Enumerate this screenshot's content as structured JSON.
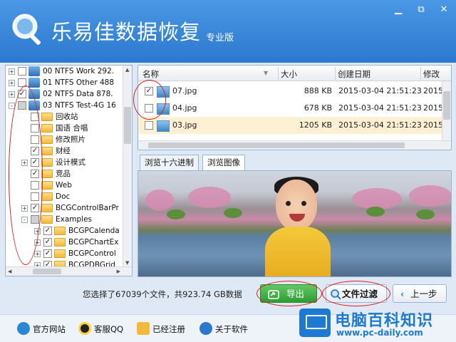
{
  "header": {
    "title": "乐易佳数据恢复",
    "edition": "专业版",
    "window_buttons": [
      "▁",
      "⧉",
      "✕"
    ]
  },
  "tree": {
    "rows": [
      {
        "indent": 0,
        "expander": "+",
        "checkbox": "unchecked",
        "icon": "drive",
        "label": "00  NTFS  Work  292."
      },
      {
        "indent": 0,
        "expander": "+",
        "checkbox": "unchecked",
        "icon": "drive",
        "label": "01  NTFS  Other  488"
      },
      {
        "indent": 0,
        "expander": "+",
        "checkbox": "checked",
        "icon": "drive",
        "label": "02  NTFS  Data  878."
      },
      {
        "indent": 0,
        "expander": "-",
        "checkbox": "partial",
        "icon": "drive",
        "label": "03  NTFS  Test-4G  16"
      },
      {
        "indent": 1,
        "expander": "",
        "checkbox": "unchecked",
        "icon": "folder",
        "label": "回收站"
      },
      {
        "indent": 1,
        "expander": "",
        "checkbox": "unchecked",
        "icon": "folder",
        "label": "国语 合唱"
      },
      {
        "indent": 1,
        "expander": "",
        "checkbox": "unchecked",
        "icon": "folder",
        "label": "修改照片"
      },
      {
        "indent": 1,
        "expander": "",
        "checkbox": "checked",
        "icon": "folder",
        "label": "财经"
      },
      {
        "indent": 1,
        "expander": "+",
        "checkbox": "checked",
        "icon": "folder",
        "label": "设计模式"
      },
      {
        "indent": 1,
        "expander": "",
        "checkbox": "checked",
        "icon": "folder",
        "label": "竞品"
      },
      {
        "indent": 1,
        "expander": "",
        "checkbox": "unchecked",
        "icon": "folder",
        "label": "Web"
      },
      {
        "indent": 1,
        "expander": "",
        "checkbox": "unchecked",
        "icon": "folder",
        "label": "Doc"
      },
      {
        "indent": 1,
        "expander": "+",
        "checkbox": "checked",
        "icon": "folder",
        "label": "BCGControlBarPr"
      },
      {
        "indent": 1,
        "expander": "-",
        "checkbox": "partial",
        "icon": "folder",
        "label": "Examples"
      },
      {
        "indent": 2,
        "expander": "+",
        "checkbox": "checked",
        "icon": "folder",
        "label": "BCGPCalenda"
      },
      {
        "indent": 2,
        "expander": "+",
        "checkbox": "checked",
        "icon": "folder",
        "label": "BCGPChartEx"
      },
      {
        "indent": 2,
        "expander": "+",
        "checkbox": "checked",
        "icon": "folder",
        "label": "BCGPControl"
      },
      {
        "indent": 2,
        "expander": "+",
        "checkbox": "checked",
        "icon": "folder",
        "label": "BCGPDBGrid"
      }
    ]
  },
  "filelist": {
    "columns": [
      "名称",
      "大小",
      "创建日期",
      "修改"
    ],
    "rows": [
      {
        "name": "07.jpg",
        "size": "888 KB",
        "created": "2015-03-04  21:51:23",
        "modified": "2015",
        "checked": true,
        "selected": false
      },
      {
        "name": "04.jpg",
        "size": "678 KB",
        "created": "2015-03-04  21:51:23",
        "modified": "2015",
        "checked": false,
        "selected": false
      },
      {
        "name": "03.jpg",
        "size": "1205 KB",
        "created": "2015-03-04  21:51:23",
        "modified": "2015",
        "checked": false,
        "selected": true
      }
    ]
  },
  "tabs": [
    {
      "label": "浏览十六进制",
      "active": false
    },
    {
      "label": "浏览图像",
      "active": true
    }
  ],
  "status": "您选择了67039个文件，共923.74 GB数据",
  "actions": {
    "export": "导出",
    "filter": "文件过滤",
    "back": "上一步"
  },
  "footer": {
    "links": [
      {
        "label": "官方网站",
        "icon": "ie-icon"
      },
      {
        "label": "客服QQ",
        "icon": "qq-icon"
      },
      {
        "label": "已经注册",
        "icon": "key-icon"
      },
      {
        "label": "关于软件",
        "icon": "info-icon"
      }
    ]
  },
  "watermark": {
    "title": "电脑百科知识",
    "url": "www.pc-daily.com"
  },
  "colors": {
    "header": "#2b78cf",
    "export": "#2e9d33",
    "selected_row": "#fdf0d3",
    "annotation": "#e21c1c"
  }
}
